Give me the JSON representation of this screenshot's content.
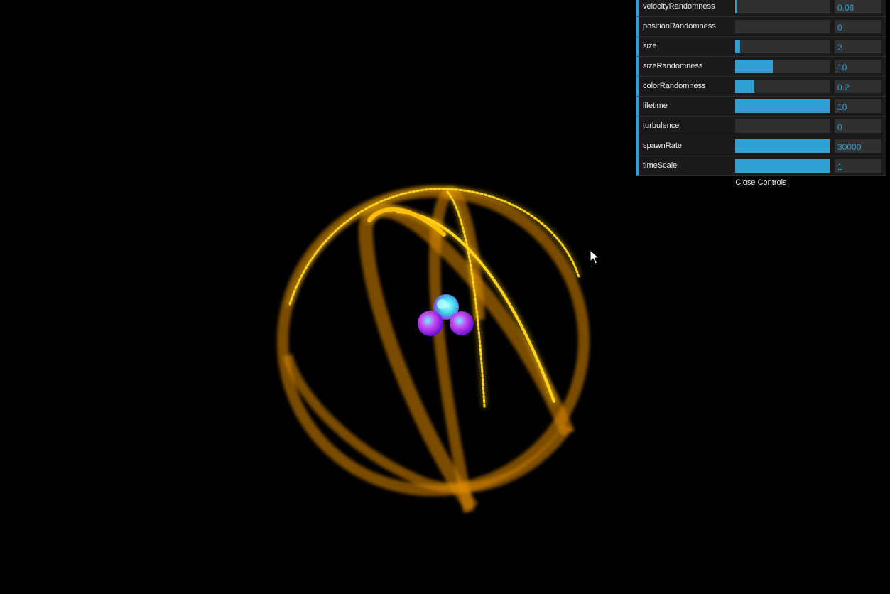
{
  "gui": {
    "controls": [
      {
        "label": "velocityRandomness",
        "value": "0.06",
        "fraction": 0.02
      },
      {
        "label": "positionRandomness",
        "value": "0",
        "fraction": 0.0
      },
      {
        "label": "size",
        "value": "2",
        "fraction": 0.05
      },
      {
        "label": "sizeRandomness",
        "value": "10",
        "fraction": 0.4
      },
      {
        "label": "colorRandomness",
        "value": "0.2",
        "fraction": 0.2
      },
      {
        "label": "lifetime",
        "value": "10",
        "fraction": 1.0
      },
      {
        "label": "turbulence",
        "value": "0",
        "fraction": 0.0
      },
      {
        "label": "spawnRate",
        "value": "30000",
        "fraction": 1.0
      },
      {
        "label": "timeScale",
        "value": "1",
        "fraction": 1.0
      }
    ],
    "close_label": "Close Controls",
    "accent_color": "#2fa1d6",
    "panel_color": "#1a1a1a"
  },
  "scene": {
    "background": "#000000",
    "particle_color": "#ffb000",
    "particle_head_color": "#ffe000",
    "emitter_colors": [
      "#7a12d6",
      "#2ad4e6",
      "#c840e8"
    ]
  }
}
